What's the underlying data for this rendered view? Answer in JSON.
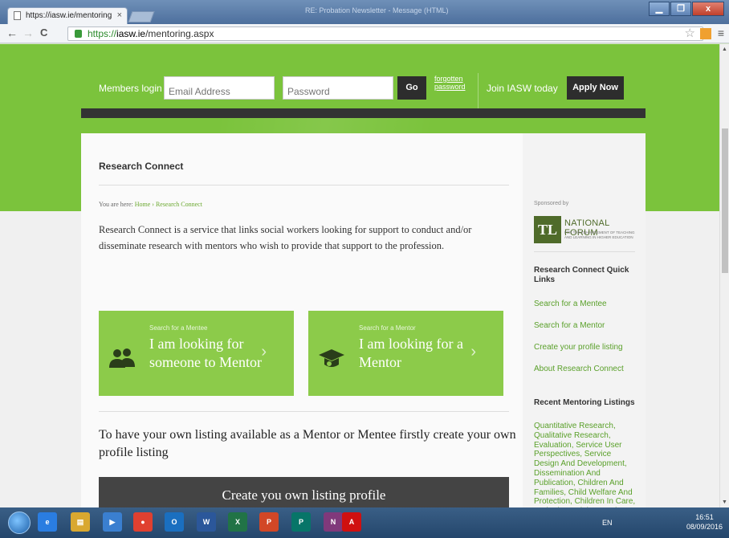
{
  "window": {
    "title": "RE: Probation Newsletter - Message (HTML)",
    "tab_title": "https://iasw.ie/mentoring",
    "tab_close": "×",
    "buttons": [
      "▁",
      "❐",
      "x"
    ]
  },
  "addressbar": {
    "back": "←",
    "forward": "→",
    "reload": "C",
    "url_scheme": "https://",
    "url_host": "iasw.ie",
    "url_path": "/mentoring.aspx",
    "star": "☆",
    "menu": "≡"
  },
  "login": {
    "label": "Members login",
    "email_placeholder": "Email Address",
    "password_placeholder": "Password",
    "go": "Go",
    "forgot": "forgotten password",
    "join": "Join IASW today",
    "apply": "Apply Now"
  },
  "main": {
    "title": "Research Connect",
    "breadcrumb_prefix": "You are here:",
    "breadcrumb_home": "Home",
    "breadcrumb_sep": "›",
    "breadcrumb_current": "Research Connect",
    "intro": "Research Connect is a service that links social workers looking for support to conduct and/or disseminate research with mentors who wish to provide that support to the profession.",
    "cards": [
      {
        "kicker": "Search for a Mentee",
        "headline": "I am looking for someone to Mentor",
        "chevron": "›",
        "icon": "people-icon"
      },
      {
        "kicker": "Search for a Mentor",
        "headline": "I am looking for a Mentor",
        "chevron": "›",
        "icon": "graduation-cap-icon"
      }
    ],
    "cta_text": "To have your own listing available as a Mentor or Mentee firstly create your own profile listing",
    "cta_button": "Create you own listing profile"
  },
  "sidebar": {
    "sponsored_by": "Sponsored by",
    "logo_letters": "TL",
    "logo_title": "NATIONAL FORUM",
    "logo_subtitle": "FOR THE ENHANCEMENT OF TEACHING AND LEARNING IN HIGHER EDUCATION",
    "quick_links_heading": "Research Connect Quick Links",
    "quick_links": [
      "Search for a Mentee",
      "Search for a Mentor",
      "Create your profile listing",
      "About Research Connect"
    ],
    "recent_heading": "Recent Mentoring Listings",
    "recent_listings": "Quantitative Research, Qualitative Research, Evaluation, Service User Perspectives, Service Design And Development, Dissemination And Publication, Children And Families, Child Welfare And Protection, Children In Care, Probation, Adult Mental Health, Child Mental"
  },
  "taskbar": {
    "apps": [
      {
        "name": "internet-explorer-icon",
        "glyph": "e",
        "color": "#2a7de1"
      },
      {
        "name": "file-explorer-icon",
        "glyph": "▤",
        "color": "#d9a830"
      },
      {
        "name": "media-player-icon",
        "glyph": "▶",
        "color": "#3a7fd0"
      },
      {
        "name": "chrome-icon",
        "glyph": "●",
        "color": "#e04030"
      },
      {
        "name": "outlook-icon",
        "glyph": "O",
        "color": "#1a6fc0"
      },
      {
        "name": "word-icon",
        "glyph": "W",
        "color": "#2b579a"
      },
      {
        "name": "excel-icon",
        "glyph": "X",
        "color": "#217346"
      },
      {
        "name": "powerpoint-icon",
        "glyph": "P",
        "color": "#d24726"
      },
      {
        "name": "publisher-icon",
        "glyph": "P",
        "color": "#077568"
      },
      {
        "name": "onenote-icon",
        "glyph": "N",
        "color": "#80397b"
      },
      {
        "name": "acrobat-icon",
        "glyph": "A",
        "color": "#d01010"
      }
    ],
    "lang": "EN",
    "time": "16:51",
    "date": "08/09/2016"
  }
}
